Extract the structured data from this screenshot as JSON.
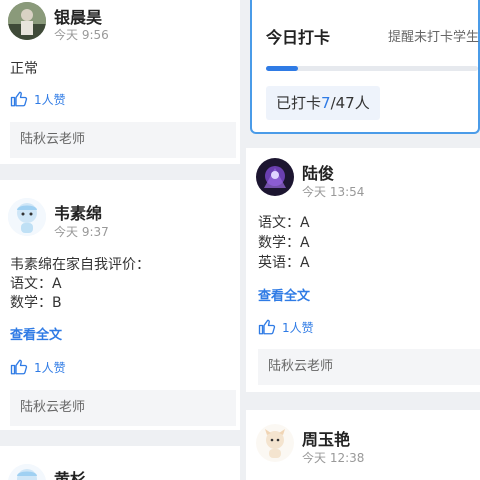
{
  "left_posts": [
    {
      "name": "银晨昊",
      "time": "今天 9:56",
      "text": "正常",
      "likes": "1人赞",
      "reviewer": "陆秋云老师"
    },
    {
      "name": "韦素绵",
      "time": "今天 9:37",
      "lines": [
        "韦素绵在家自我评价：",
        "语文：A",
        "数学：B"
      ],
      "more": "查看全文",
      "likes": "1人赞",
      "reviewer": "陆秋云老师"
    },
    {
      "name": "黄杉"
    }
  ],
  "checkin_panel": {
    "title": "今日打卡",
    "remind": "提醒未打卡学生",
    "progress": 0.149,
    "checked_prefix": "已打卡",
    "checked_count": "7",
    "checked_suffix": "/47人"
  },
  "right_posts": [
    {
      "name": "陆俊",
      "time": "今天 13:54",
      "lines": [
        "语文：A",
        "数学：A",
        "英语：A"
      ],
      "more": "查看全文",
      "likes": "1人赞",
      "reviewer": "陆秋云老师"
    },
    {
      "name": "周玉艳",
      "time": "今天 12:38"
    }
  ],
  "colors": {
    "accent": "#2f7be5",
    "background": "#eef0f3",
    "panel_border": "#4a9be8"
  }
}
